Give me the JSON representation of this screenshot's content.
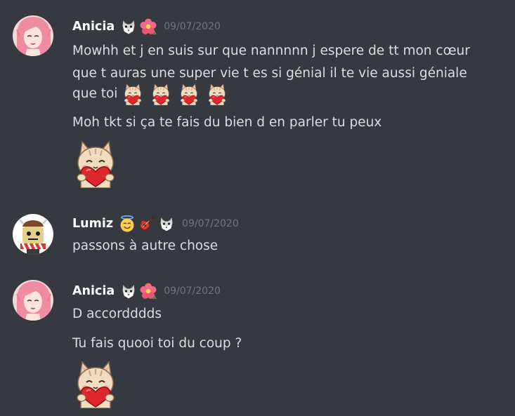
{
  "messages": [
    {
      "author": "Anicia",
      "badges": [
        "wolf-icon",
        "flower-icon"
      ],
      "timestamp": "09/07/2020",
      "lines": [
        "Mowhh et j en suis sur que nannnnn j espere de tt mon cœur",
        "que t auras une super vie t es si génial il te vie aussi géniale",
        "que toi",
        "Moh tkt si ça te fais du bien d en parler tu peux"
      ],
      "inline_emojis": [
        "cat-heart-emoji",
        "cat-heart-emoji",
        "cat-heart-emoji",
        "cat-heart-emoji"
      ],
      "big_emoji": "cat-heart-emoji"
    },
    {
      "author": "Lumiz",
      "badges": [
        "angel-emoji-icon",
        "guitar-icon",
        "wolf-icon"
      ],
      "timestamp": "09/07/2020",
      "lines": [
        "passons à autre chose"
      ]
    },
    {
      "author": "Anicia",
      "badges": [
        "wolf-icon",
        "flower-icon"
      ],
      "timestamp": "09/07/2020",
      "lines": [
        "D accordddds",
        "Tu fais quooi toi du coup ?"
      ],
      "big_emoji": "cat-heart-emoji"
    }
  ],
  "colors": {
    "background": "#36393f",
    "author": "#ffffff",
    "text": "#dcddde",
    "timestamp": "#72767d"
  }
}
